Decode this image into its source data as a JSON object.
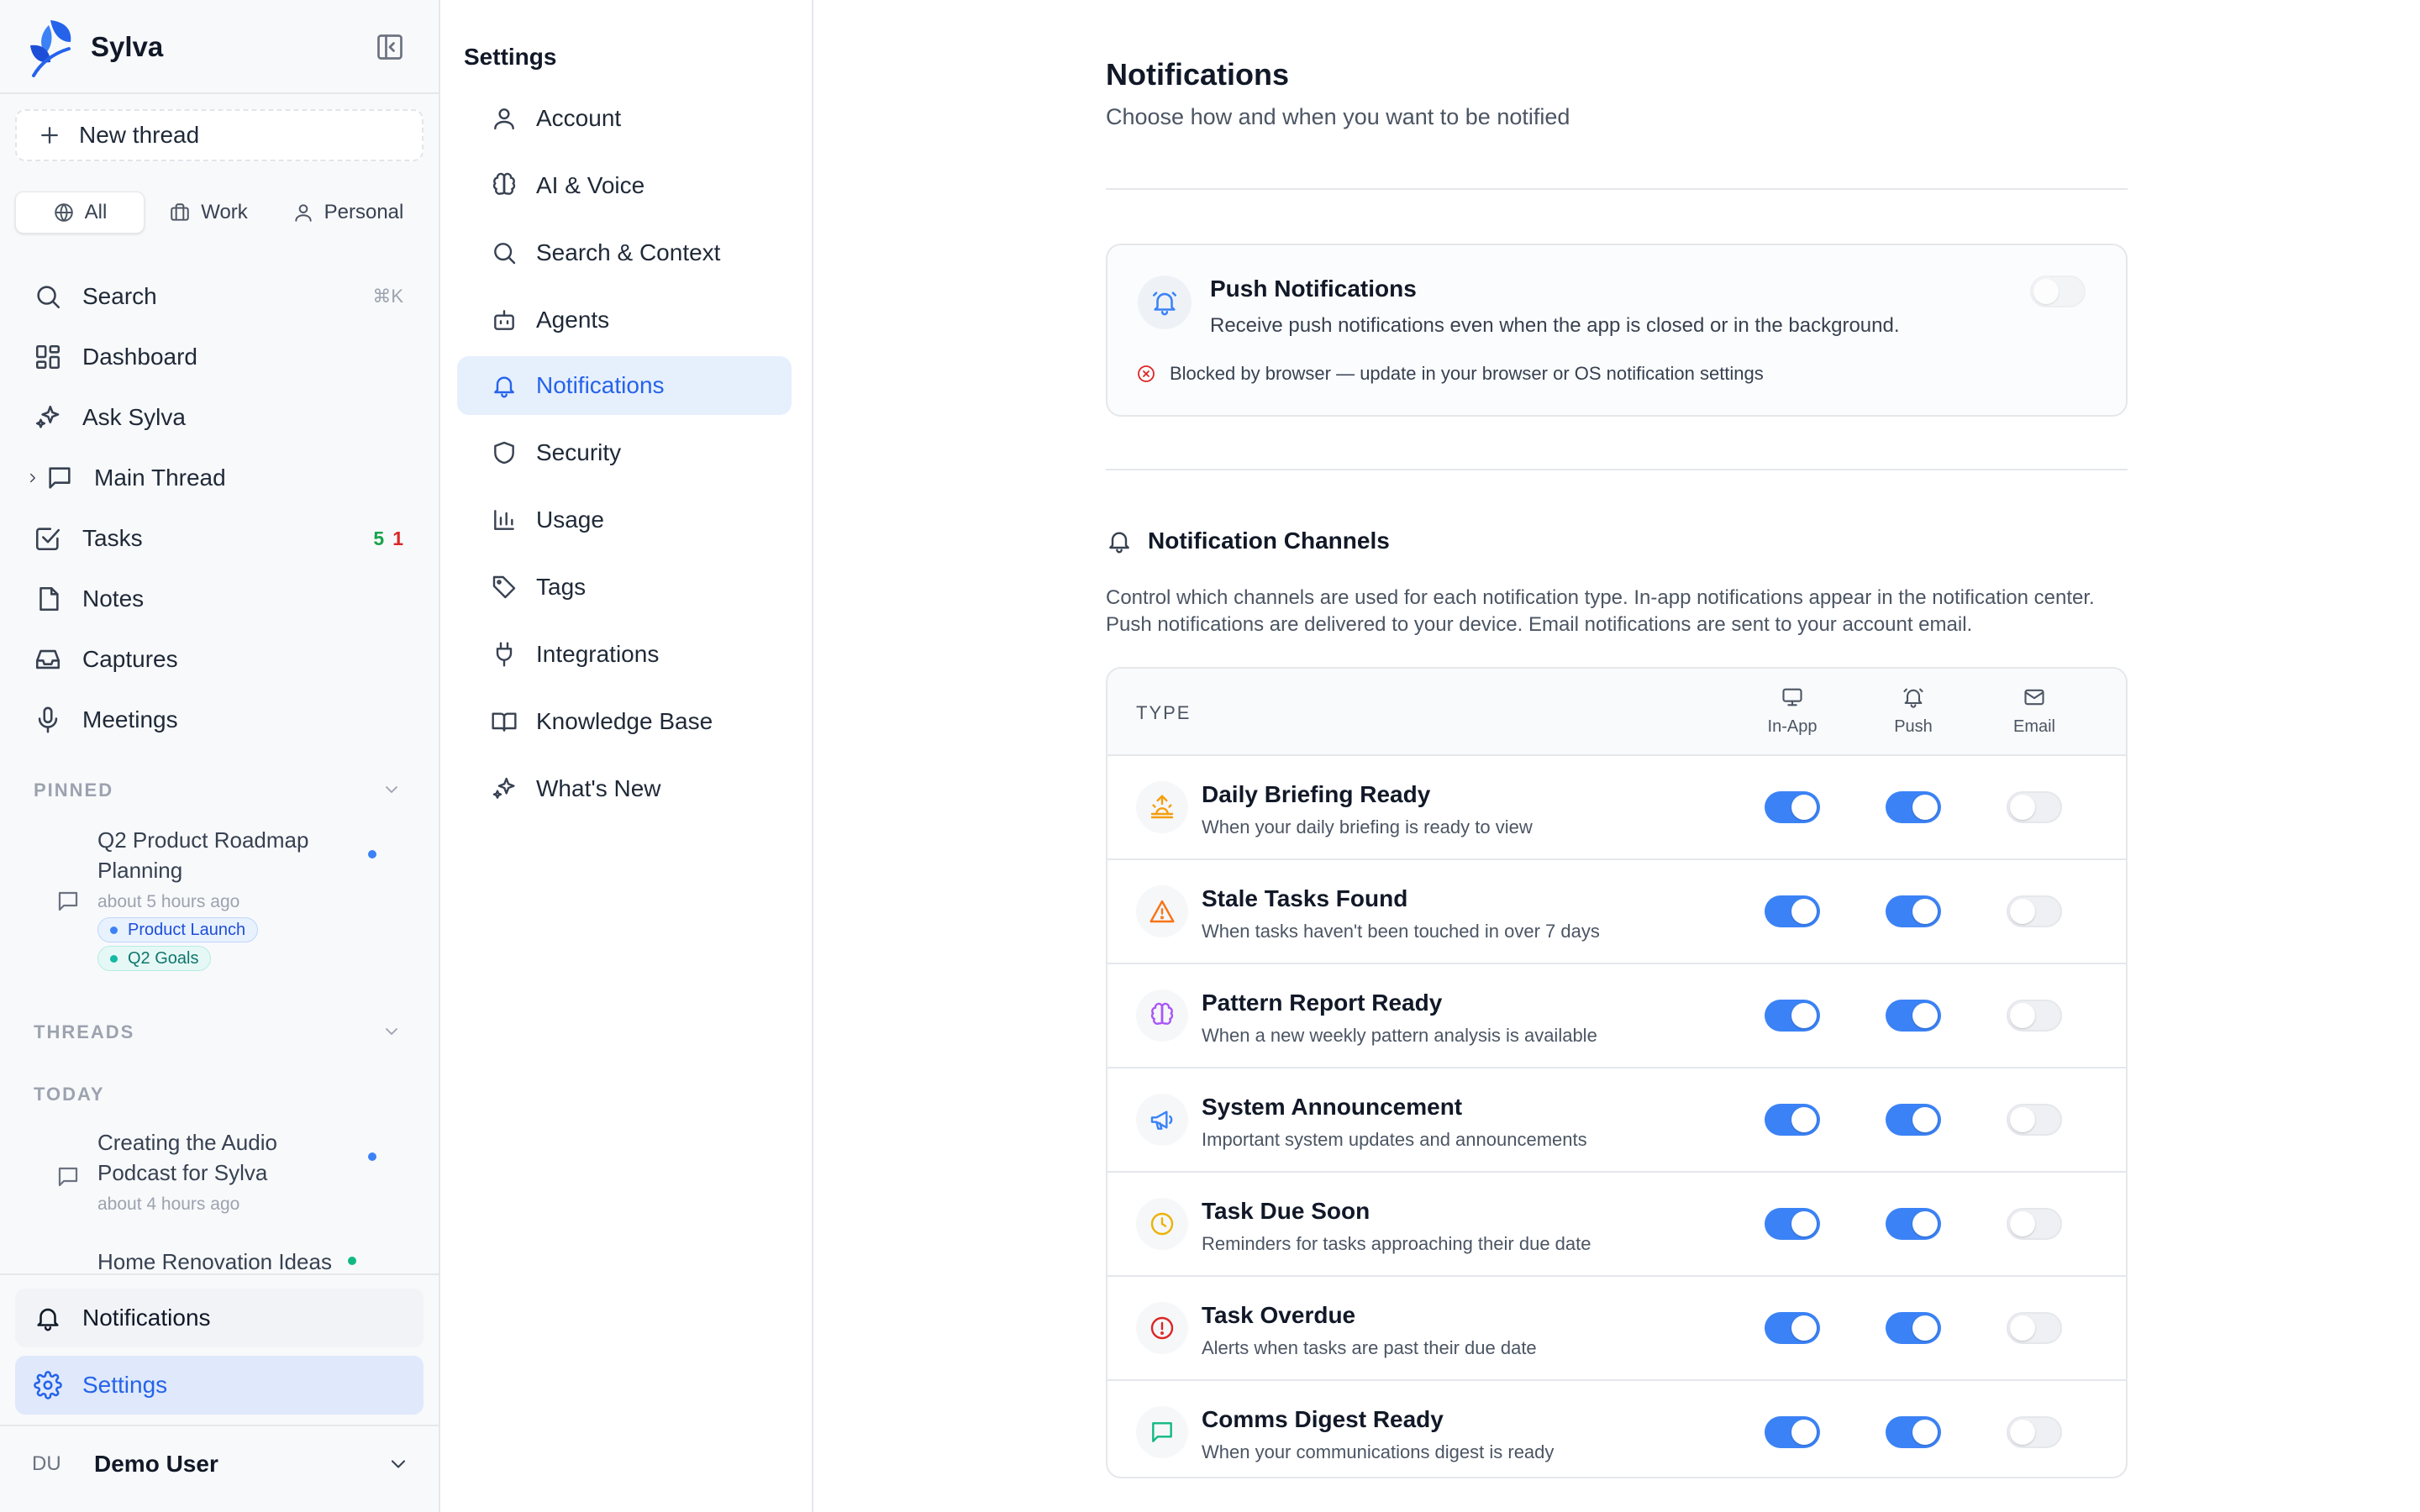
{
  "app": {
    "name": "Sylva"
  },
  "sidebar": {
    "new_thread_label": "New thread",
    "scopes": [
      {
        "label": "All",
        "icon": "globe-icon",
        "active": true
      },
      {
        "label": "Work",
        "icon": "briefcase-icon",
        "active": false
      },
      {
        "label": "Personal",
        "icon": "user-icon",
        "active": false
      }
    ],
    "nav": [
      {
        "label": "Search",
        "icon": "search-icon",
        "shortcut": "⌘K"
      },
      {
        "label": "Dashboard",
        "icon": "dashboard-icon"
      },
      {
        "label": "Ask Sylva",
        "icon": "sparkles-icon"
      },
      {
        "label": "Main Thread",
        "icon": "message-icon"
      },
      {
        "label": "Tasks",
        "icon": "checkbox-icon",
        "count_green": "5",
        "count_red": "1"
      },
      {
        "label": "Notes",
        "icon": "note-icon"
      },
      {
        "label": "Captures",
        "icon": "inbox-icon"
      },
      {
        "label": "Meetings",
        "icon": "microphone-icon"
      }
    ],
    "pinned_label": "PINNED",
    "pinned": [
      {
        "title": "Q2 Product Roadmap Planning",
        "time": "about 5 hours ago",
        "tags": [
          {
            "label": "Product Launch",
            "color": "#3b82f6"
          },
          {
            "label": "Q2 Goals",
            "color": "#14b8a6"
          }
        ]
      }
    ],
    "threads_label": "THREADS",
    "today_label": "TODAY",
    "threads": [
      {
        "title": "Creating the Audio Podcast for Sylva",
        "time": "about 4 hours ago"
      },
      {
        "title": "Home Renovation Ideas",
        "time": ""
      }
    ],
    "bottom": {
      "notifications_label": "Notifications",
      "settings_label": "Settings"
    },
    "user": {
      "initials": "DU",
      "name": "Demo User"
    }
  },
  "settings_nav": {
    "title": "Settings",
    "items": [
      {
        "label": "Account",
        "icon": "user-icon"
      },
      {
        "label": "AI & Voice",
        "icon": "brain-icon"
      },
      {
        "label": "Search & Context",
        "icon": "search-icon"
      },
      {
        "label": "Agents",
        "icon": "bot-icon"
      },
      {
        "label": "Notifications",
        "icon": "bell-icon",
        "active": true
      },
      {
        "label": "Security",
        "icon": "shield-icon"
      },
      {
        "label": "Usage",
        "icon": "bar-chart-icon"
      },
      {
        "label": "Tags",
        "icon": "tag-icon"
      },
      {
        "label": "Integrations",
        "icon": "plug-icon"
      },
      {
        "label": "Knowledge Base",
        "icon": "book-icon"
      },
      {
        "label": "What's New",
        "icon": "sparkles-icon"
      }
    ]
  },
  "main": {
    "title": "Notifications",
    "subtitle": "Choose how and when you want to be notified",
    "push": {
      "title": "Push Notifications",
      "description": "Receive push notifications even when the app is closed or in the background.",
      "warning": "Blocked by browser — update in your browser or OS notification settings",
      "enabled": false
    },
    "channels": {
      "title": "Notification Channels",
      "description": "Control which channels are used for each notification type. In-app notifications appear in the notification center. Push notifications are delivered to your device. Email notifications are sent to your account email.",
      "type_header": "TYPE",
      "columns": [
        "In-App",
        "Push",
        "Email"
      ],
      "rows": [
        {
          "title": "Daily Briefing Ready",
          "desc": "When your daily briefing is ready to view",
          "icon": "sunrise-icon",
          "icon_color": "#f59e0b",
          "in_app": true,
          "push": true,
          "email": false
        },
        {
          "title": "Stale Tasks Found",
          "desc": "When tasks haven't been touched in over 7 days",
          "icon": "warning-icon",
          "icon_color": "#f97316",
          "in_app": true,
          "push": true,
          "email": false
        },
        {
          "title": "Pattern Report Ready",
          "desc": "When a new weekly pattern analysis is available",
          "icon": "brain-icon",
          "icon_color": "#a855f7",
          "in_app": true,
          "push": true,
          "email": false
        },
        {
          "title": "System Announcement",
          "desc": "Important system updates and announcements",
          "icon": "megaphone-icon",
          "icon_color": "#3b82f6",
          "in_app": true,
          "push": true,
          "email": false
        },
        {
          "title": "Task Due Soon",
          "desc": "Reminders for tasks approaching their due date",
          "icon": "clock-icon",
          "icon_color": "#eab308",
          "in_app": true,
          "push": true,
          "email": false
        },
        {
          "title": "Task Overdue",
          "desc": "Alerts when tasks are past their due date",
          "icon": "alert-circle-icon",
          "icon_color": "#dc2626",
          "in_app": true,
          "push": true,
          "email": false
        },
        {
          "title": "Comms Digest Ready",
          "desc": "When your communications digest is ready",
          "icon": "message-icon",
          "icon_color": "#10b981",
          "in_app": true,
          "push": true,
          "email": false
        }
      ]
    }
  }
}
